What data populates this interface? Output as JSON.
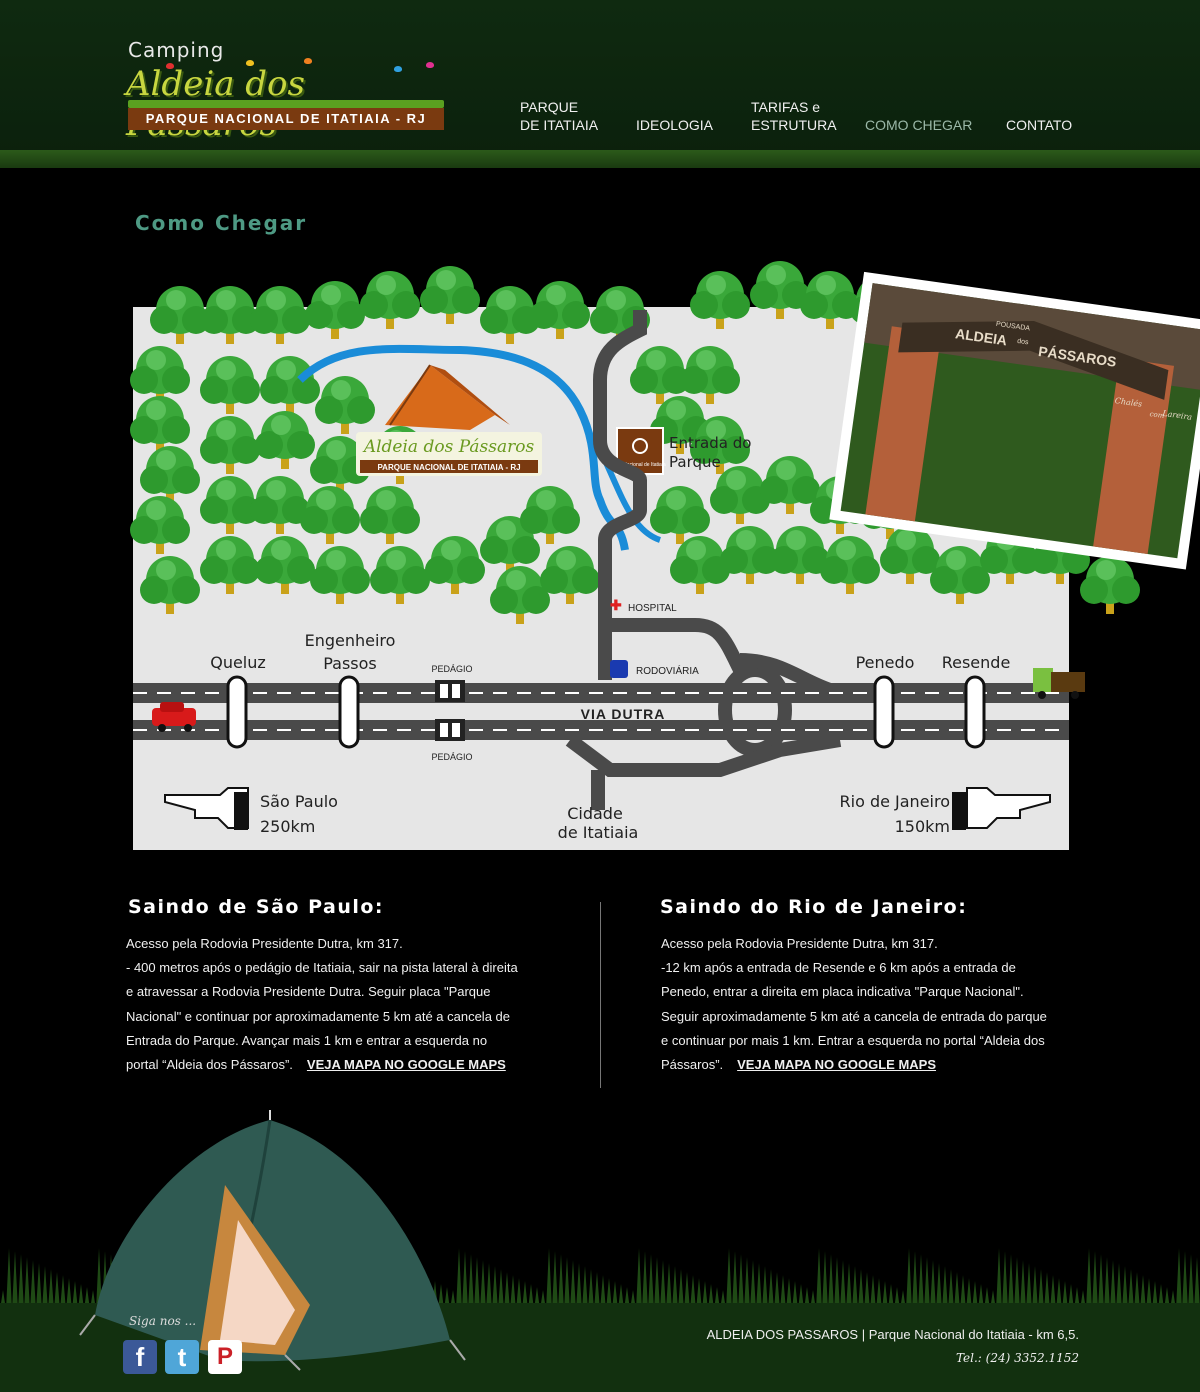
{
  "header": {
    "logo": {
      "camping": "Camping",
      "name": "Aldeia dos Pássaros",
      "subtitle": "PARQUE NACIONAL DE ITATIAIA - RJ"
    },
    "nav": [
      {
        "line1": "PARQUE",
        "line2": "DE ITATIAIA",
        "active": false
      },
      {
        "line1": "",
        "line2": "IDEOLOGIA",
        "active": false
      },
      {
        "line1": "TARIFAS e",
        "line2": "ESTRUTURA",
        "active": false
      },
      {
        "line1": "",
        "line2": "COMO CHEGAR",
        "active": true
      },
      {
        "line1": "",
        "line2": "CONTATO",
        "active": false
      }
    ]
  },
  "page_title": "Como Chegar",
  "map": {
    "logo_name": "Aldeia dos Pássaros",
    "logo_subtitle": "PARQUE NACIONAL DE ITATIAIA - RJ",
    "park_sign": "Pq. Nacional de Itatiaia",
    "park_entrance": [
      "Entrada do",
      "Parque"
    ],
    "hospital": "HOSPITAL",
    "rodoviaria": "RODOVIÁRIA",
    "queluz": "Queluz",
    "engenheiro": [
      "Engenheiro",
      "Passos"
    ],
    "pedagio": "PEDÁGIO",
    "via_dutra": "VIA DUTRA",
    "penedo": "Penedo",
    "resende": "Resende",
    "sao_paulo": [
      "São Paulo",
      "250km"
    ],
    "rio": [
      "Rio de Janeiro",
      "150km"
    ],
    "cidade": [
      "Cidade",
      "de Itatiaia"
    ],
    "photo_sign": [
      "POUSADA",
      "ALDEIA",
      "dos",
      "PÁSSAROS",
      "Chalés",
      "com",
      "Lareira"
    ]
  },
  "columns": [
    {
      "title": "Saindo de São Paulo:",
      "lines": [
        "Acesso pela Rodovia Presidente Dutra, km 317.",
        "- 400 metros após o pedágio de Itatiaia, sair na pista lateral à direita",
        "e atravessar a Rodovia Presidente Dutra. Seguir placa \"Parque",
        "Nacional\" e continuar por aproximadamente 5 km até a cancela de",
        "Entrada do Parque. Avançar mais 1 km e entrar a esquerda no",
        "portal “Aldeia dos Pássaros”."
      ],
      "link": "VEJA MAPA NO GOOGLE MAPS"
    },
    {
      "title": "Saindo do Rio de Janeiro:",
      "lines": [
        "Acesso pela Rodovia Presidente Dutra, km 317.",
        "-12 km após a entrada de Resende e 6 km após a entrada de",
        "Penedo, entrar a direita em placa indicativa \"Parque Nacional\".",
        "Seguir aproximadamente 5 km até a cancela de entrada do parque",
        "e continuar por mais 1 km. Entrar a esquerda no portal “Aldeia dos",
        "Pássaros”."
      ],
      "link": "VEJA MAPA NO GOOGLE MAPS"
    }
  ],
  "footer": {
    "follow": "Siga nos ...",
    "social": [
      {
        "name": "facebook-icon",
        "glyph": "f",
        "color": "#3b5998"
      },
      {
        "name": "twitter-icon",
        "glyph": "t",
        "color": "#4fa6d8"
      },
      {
        "name": "pinterest-icon",
        "glyph": "P",
        "color": "#ffffff"
      }
    ],
    "address": "ALDEIA DOS PASSAROS  |  Parque Nacional do Itatiaia - km 6,5.",
    "tel": "Tel.: (24) 3352.1152"
  },
  "colors": {
    "header_bg": "#0f2a10",
    "title_teal": "#4e9a84",
    "footer_bg": "#12300f",
    "map_bg": "#e6e6e6",
    "road": "#4a4a4a",
    "river": "#1a8cd8"
  }
}
